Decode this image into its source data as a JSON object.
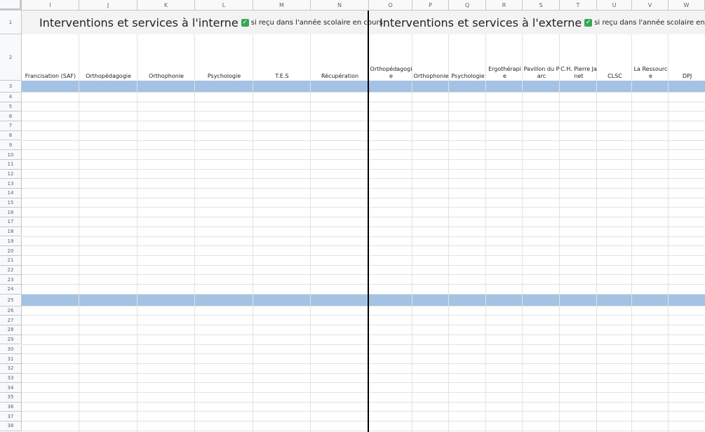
{
  "sheet": {
    "columns": [
      "I",
      "J",
      "K",
      "L",
      "M",
      "N",
      "O",
      "P",
      "Q",
      "R",
      "S",
      "T",
      "U",
      "V",
      "W"
    ],
    "rows": [
      "1",
      "2",
      "3",
      "4",
      "5",
      "6",
      "7",
      "8",
      "9",
      "10",
      "11",
      "12",
      "13",
      "14",
      "15",
      "16",
      "17",
      "18",
      "19",
      "20",
      "21",
      "22",
      "23",
      "24",
      "25",
      "26",
      "27",
      "28",
      "29",
      "30",
      "31",
      "32",
      "33",
      "34",
      "35",
      "36",
      "37",
      "38"
    ],
    "band_rows": [
      "3",
      "25"
    ],
    "internal": {
      "title": "Interventions et services à l'interne",
      "check_icon": "check-box-icon",
      "note": "si reçu dans l'année scolaire en cours",
      "headers": [
        "Francisation (SAF)",
        "Orthopédagogie",
        "Orthophonie",
        "Psychologie",
        "T.E.S",
        "Récupération"
      ]
    },
    "external": {
      "title": "Interventions et services à l'externe",
      "check_icon": "check-box-icon",
      "note": "si reçu dans l'année scolaire en cours",
      "headers": [
        "Orthopédagogie",
        "Orthophonie",
        "Psychologie",
        "Ergothérapie",
        "Pavillon du Parc",
        "C.H. Pierre Janet",
        "CLSC",
        "La Ressource",
        "DPJ"
      ]
    },
    "colors": {
      "band": "#a4c2e3",
      "header_bg": "#f8f9fa",
      "title_bg": "#f3f3f3",
      "check": "#34a853"
    }
  }
}
